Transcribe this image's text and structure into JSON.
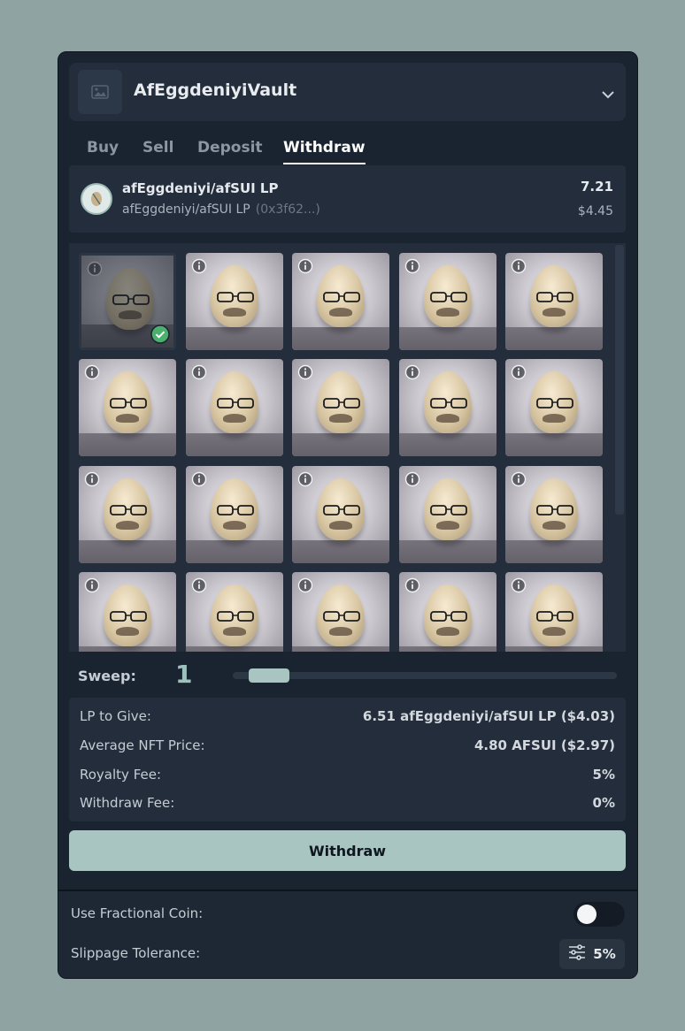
{
  "vault": {
    "name": "AfEggdeniyiVault"
  },
  "tabs": [
    {
      "label": "Buy"
    },
    {
      "label": "Sell"
    },
    {
      "label": "Deposit"
    },
    {
      "label": "Withdraw",
      "active": true
    }
  ],
  "token": {
    "name": "afEggdeniyi/afSUI LP",
    "subname": "afEggdeniyi/afSUI LP",
    "address": "(0x3f62...)",
    "amount": "7.21",
    "usd": "$4.45"
  },
  "sweep": {
    "label": "Sweep:",
    "value": "1"
  },
  "summary": {
    "lp_label": "LP to Give:",
    "lp_value": "6.51 afEggdeniyi/afSUI LP  ($4.03)",
    "avg_label": "Average NFT Price:",
    "avg_value": "4.80 AFSUI  ($2.97)",
    "royalty_label": "Royalty Fee:",
    "royalty_value": "5%",
    "withdraw_fee_label": "Withdraw Fee:",
    "withdraw_fee_value": "0%"
  },
  "action": {
    "label": "Withdraw"
  },
  "settings": {
    "fractional_label": "Use Fractional Coin:",
    "fractional_on": false,
    "slippage_label": "Slippage Tolerance:",
    "slippage_value": "5%"
  },
  "nfts": {
    "rows": 4,
    "cols": 5,
    "selected_index": 0
  },
  "colors": {
    "accent": "#a8c5c2",
    "panel": "#1a2330",
    "card": "#232d3b",
    "selected_check": "#4caf6e"
  }
}
